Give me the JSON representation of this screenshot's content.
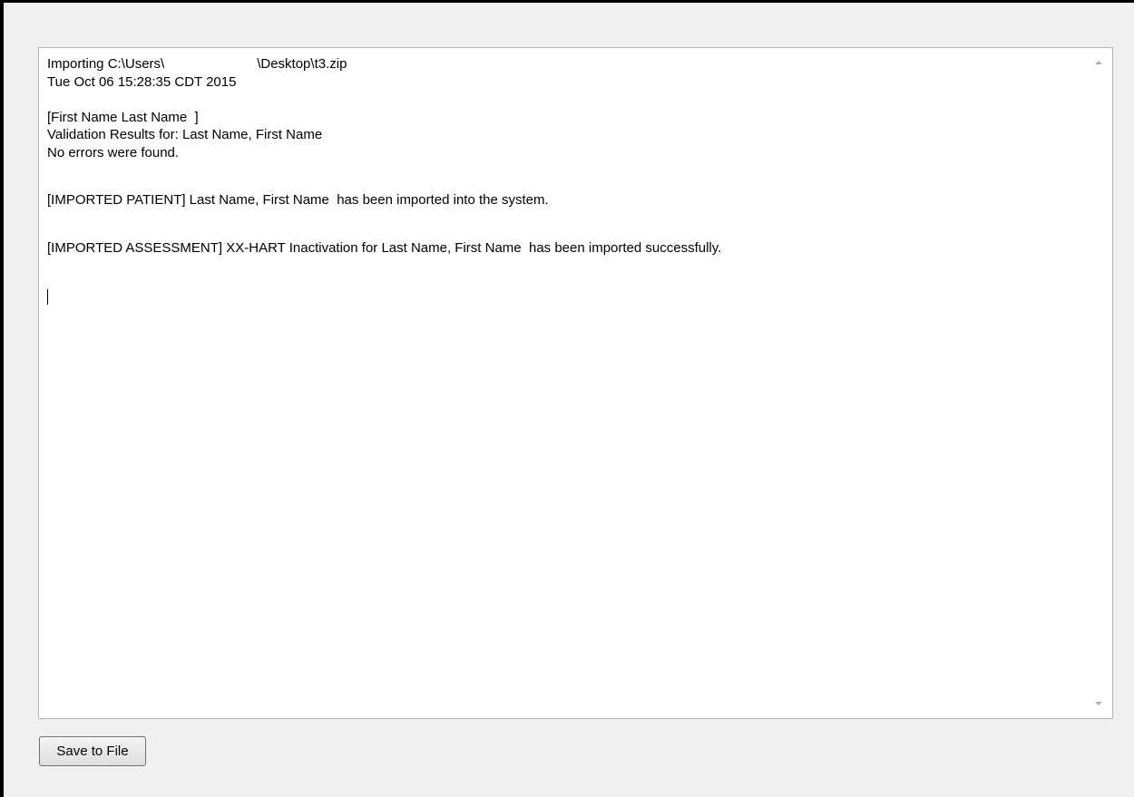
{
  "log": {
    "import_prefix": "Importing C:\\Users\\",
    "import_suffix": "\\Desktop\\t3.zip",
    "timestamp": "Tue Oct 06 15:28:35 CDT 2015",
    "patient_bracket": "[First Name Last Name  ]",
    "validation_results": "Validation Results for: Last Name, First Name",
    "no_errors": "No errors were found.",
    "imported_patient": "[IMPORTED PATIENT] Last Name, First Name  has been imported into the system.",
    "imported_assessment": "[IMPORTED ASSESSMENT] XX-HART Inactivation for Last Name, First Name  has been imported successfully."
  },
  "scrollbar": {
    "up_icon": "scroll-up-arrow",
    "down_icon": "scroll-down-arrow"
  },
  "actions": {
    "save_label": "Save to File"
  }
}
